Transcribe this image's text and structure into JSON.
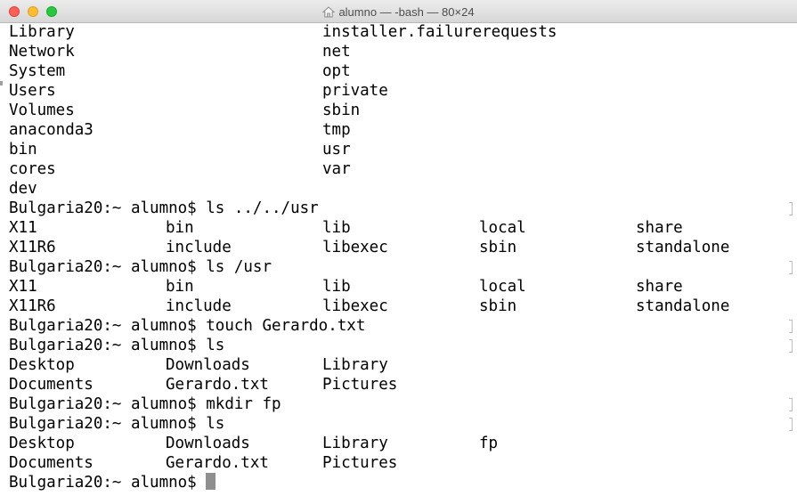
{
  "window": {
    "title": "alumno — -bash — 80×24",
    "controls": [
      "close-button",
      "minimize-button",
      "zoom-button"
    ],
    "icon": "home-folder-icon",
    "accent_close": "#fe5f57",
    "accent_min": "#febc2e",
    "accent_max": "#28c840"
  },
  "terminal": {
    "prompt": "Bulgaria20:~ alumno$ ",
    "lines": [
      {
        "cols": [
          "Library",
          "",
          "installer.failurerequests"
        ]
      },
      {
        "cols": [
          "Network",
          "",
          "net"
        ]
      },
      {
        "cols": [
          "System",
          "",
          "opt"
        ]
      },
      {
        "cols": [
          "Users",
          "",
          "private"
        ]
      },
      {
        "cols": [
          "Volumes",
          "",
          "sbin"
        ]
      },
      {
        "cols": [
          "anaconda3",
          "",
          "tmp"
        ]
      },
      {
        "cols": [
          "bin",
          "",
          "usr"
        ]
      },
      {
        "cols": [
          "cores",
          "",
          "var"
        ]
      },
      {
        "cols": [
          "dev"
        ]
      },
      {
        "text": "Bulgaria20:~ alumno$ ls ../../usr",
        "marked": true
      },
      {
        "cols": [
          "X11",
          "bin",
          "lib",
          "local",
          "share"
        ]
      },
      {
        "cols": [
          "X11R6",
          "include",
          "libexec",
          "sbin",
          "standalone"
        ]
      },
      {
        "text": "Bulgaria20:~ alumno$ ls /usr",
        "marked": true
      },
      {
        "cols": [
          "X11",
          "bin",
          "lib",
          "local",
          "share"
        ]
      },
      {
        "cols": [
          "X11R6",
          "include",
          "libexec",
          "sbin",
          "standalone"
        ]
      },
      {
        "text": "Bulgaria20:~ alumno$ touch Gerardo.txt",
        "marked": true
      },
      {
        "text": "Bulgaria20:~ alumno$ ls",
        "marked": true
      },
      {
        "cols": [
          "Desktop",
          "Downloads",
          "Library"
        ]
      },
      {
        "cols": [
          "Documents",
          "Gerardo.txt",
          "Pictures"
        ]
      },
      {
        "text": "Bulgaria20:~ alumno$ mkdir fp",
        "marked": true
      },
      {
        "text": "Bulgaria20:~ alumno$ ls",
        "marked": true
      },
      {
        "cols": [
          "Desktop",
          "Downloads",
          "Library",
          "fp"
        ]
      },
      {
        "cols": [
          "Documents",
          "Gerardo.txt",
          "Pictures"
        ]
      },
      {
        "text": "Bulgaria20:~ alumno$ ",
        "cursor": true
      }
    ]
  }
}
